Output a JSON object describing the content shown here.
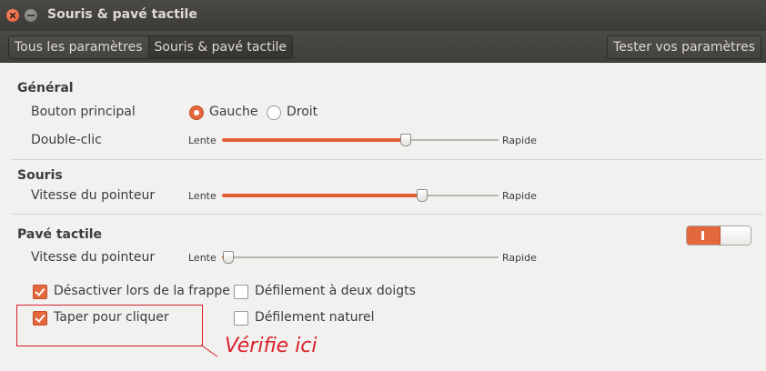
{
  "window": {
    "title": "Souris & pavé tactile"
  },
  "toolbar": {
    "breadcrumbs": [
      "Tous les paramètres",
      "Souris & pavé tactile"
    ],
    "test_button": "Tester vos paramètres"
  },
  "general": {
    "title": "Général",
    "primary_button_label": "Bouton principal",
    "primary_options": [
      "Gauche",
      "Droit"
    ],
    "primary_selected": "Gauche",
    "double_click_label": "Double-clic",
    "double_click_min": "Lente",
    "double_click_max": "Rapide",
    "double_click_value": 0.66
  },
  "mouse": {
    "title": "Souris",
    "speed_label": "Vitesse du pointeur",
    "speed_min": "Lente",
    "speed_max": "Rapide",
    "speed_value": 0.72
  },
  "touchpad": {
    "title": "Pavé tactile",
    "enabled": true,
    "speed_label": "Vitesse du pointeur",
    "speed_min": "Lente",
    "speed_max": "Rapide",
    "speed_value": 0.02,
    "options": [
      {
        "label": "Désactiver lors de la frappe",
        "checked": true
      },
      {
        "label": "Défilement à deux doigts",
        "checked": false
      },
      {
        "label": "Taper pour cliquer",
        "checked": true
      },
      {
        "label": "Défilement naturel",
        "checked": false
      }
    ]
  },
  "annotation": {
    "text": "Vérifie ici",
    "color": "#d8202a"
  },
  "colors": {
    "accent": "#e4683d",
    "titlebar": "#3c3b37",
    "background": "#f2f1f0"
  }
}
